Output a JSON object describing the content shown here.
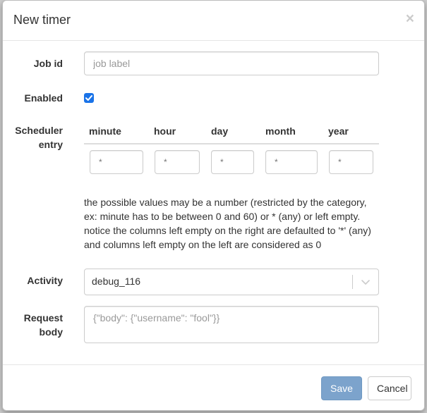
{
  "modal": {
    "title": "New timer",
    "close_glyph": "×"
  },
  "job_id": {
    "label": "Job id",
    "value": "",
    "placeholder": "job label"
  },
  "enabled": {
    "label": "Enabled",
    "checked": true
  },
  "scheduler": {
    "label_line1": "Scheduler",
    "label_line2": "entry",
    "columns": [
      {
        "header": "minute",
        "value": "*"
      },
      {
        "header": "hour",
        "value": "*"
      },
      {
        "header": "day",
        "value": "*"
      },
      {
        "header": "month",
        "value": "*"
      },
      {
        "header": "year",
        "value": "*"
      }
    ]
  },
  "help": {
    "line1": "the possible values may be a number (restricted by the category,",
    "line2": "ex: minute has to be between 0 and 60) or * (any) or left empty.",
    "line3": "notice the columns left empty on the right are defaulted to '*' (any)",
    "line4": "and columns left empty on the left are considered as 0"
  },
  "activity": {
    "label": "Activity",
    "selected": "debug_116"
  },
  "request_body": {
    "label_line1": "Request",
    "label_line2": "body",
    "value": "",
    "placeholder": "{\"body\": {\"username\": \"fool\"}}"
  },
  "footer": {
    "save_label": "Save",
    "cancel_label": "Cancel"
  },
  "colors": {
    "accent": "#1a73e8",
    "save_button": "#7ca3cc"
  }
}
